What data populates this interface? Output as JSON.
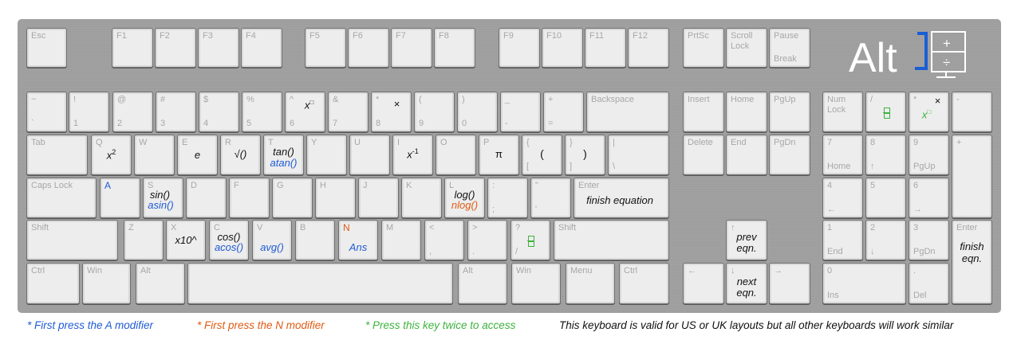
{
  "logo": {
    "text": "Alt",
    "plus": "+",
    "div": "÷",
    "accent": "#1a5ed6",
    "color": "#ffffff"
  },
  "legend": {
    "a": "* First press the A modifier",
    "n": "* First press the N modifier",
    "twice": "* Press this key twice to access",
    "note": "This keyboard is valid for US or UK layouts but all other keyboards will work similar"
  },
  "keys": {
    "esc": "Esc",
    "f1": "F1",
    "f2": "F2",
    "f3": "F3",
    "f4": "F4",
    "f5": "F5",
    "f6": "F6",
    "f7": "F7",
    "f8": "F8",
    "f9": "F9",
    "f10": "F10",
    "f11": "F11",
    "f12": "F12",
    "prtsc": "PrtSc",
    "scroll1": "Scroll",
    "scroll2": "Lock",
    "pause1": "Pause",
    "pause2": "Break",
    "tilde_t": "~",
    "tilde_b": "`",
    "k1_t": "!",
    "k1_b": "1",
    "k2_t": "@",
    "k2_b": "2",
    "k3_t": "#",
    "k3_b": "3",
    "k4_t": "$",
    "k4_b": "4",
    "k5_t": "%",
    "k5_b": "5",
    "k6_t": "^",
    "k6_b": "6",
    "k7_t": "&",
    "k7_b": "7",
    "k8_t": "*",
    "k8_b": "8",
    "k9_t": "(",
    "k9_b": "9",
    "k0_t": ")",
    "k0_b": "0",
    "minus_t": "_",
    "minus_b": "-",
    "eq_t": "+",
    "eq_b": "=",
    "backspace": "Backspace",
    "insert": "Insert",
    "home": "Home",
    "pgup": "PgUp",
    "numlock1": "Num",
    "numlock2": "Lock",
    "np_div": "/",
    "np_mul": "*",
    "np_minus": "-",
    "tab": "Tab",
    "q": "Q",
    "w": "W",
    "e": "E",
    "r": "R",
    "t": "T",
    "y": "Y",
    "u": "U",
    "i": "I",
    "o": "O",
    "p": "P",
    "lbr_t": "{",
    "lbr_b": "[",
    "rbr_t": "}",
    "rbr_b": "]",
    "pipe_t": "|",
    "pipe_b": "\\",
    "delete": "Delete",
    "end": "End",
    "pgdn": "PgDn",
    "np7": "7",
    "np7_b": "Home",
    "np8": "8",
    "np8_b": "↑",
    "np9": "9",
    "np9_b": "PgUp",
    "np_plus": "+",
    "caps": "Caps Lock",
    "a": "A",
    "s": "S",
    "d": "D",
    "f": "F",
    "g": "G",
    "h": "H",
    "j": "J",
    "k": "K",
    "l": "L",
    "semi_t": ":",
    "semi_b": ";",
    "quote_t": "\"",
    "quote_b": "'",
    "enter": "Enter",
    "np4": "4",
    "np4_b": "←",
    "np5": "5",
    "np6": "6",
    "np6_b": "→",
    "shift": "Shift",
    "z": "Z",
    "x": "X",
    "c": "C",
    "v": "V",
    "b": "B",
    "n": "N",
    "m": "M",
    "comma_t": "<",
    "comma_b": ",",
    "dot_t": ">",
    "dot_b": ".",
    "slash_t": "?",
    "slash_b": "/",
    "up_arrow": "↑",
    "np1": "1",
    "np1_b": "End",
    "np2": "2",
    "np2_b": "↓",
    "np3": "3",
    "np3_b": "PgDn",
    "np_enter": "Enter",
    "ctrl": "Ctrl",
    "win": "Win",
    "alt": "Alt",
    "menu": "Menu",
    "left_arrow": "←",
    "down_arrow": "↓",
    "right_arrow": "→",
    "np0": "0",
    "np0_b": "Ins",
    "npdot": ".",
    "npdot_b": "Del"
  },
  "functions": {
    "x_sq": "x",
    "x_sq_sup": "2",
    "x_pow": "x",
    "x_pow_sup": "□",
    "times": "×",
    "e": "e",
    "sqrt": "√()",
    "tan": "tan()",
    "atan": "atan()",
    "x_inv": "x",
    "x_inv_sup": "-1",
    "pi": "π",
    "lparen": "(",
    "rparen": ")",
    "a_mod": "A",
    "sin": "sin()",
    "asin": "asin()",
    "log": "log()",
    "nlog": "nlog()",
    "finish": "finish equation",
    "x10": "x10^",
    "cos": "cos()",
    "acos": "acos()",
    "avg": "avg()",
    "n_mod": "N",
    "ans": "Ans",
    "prev1": "prev",
    "prev2": "eqn.",
    "next1": "next",
    "next2": "eqn.",
    "np_times": "×",
    "np_xpow": "x",
    "np_xpow_sup": "□",
    "np_finish1": "finish",
    "np_finish2": "eqn."
  },
  "colors": {
    "modA": "#1f5bd6",
    "modN": "#e05a12",
    "twice": "#3cb33c",
    "legend_text": "#111111"
  }
}
